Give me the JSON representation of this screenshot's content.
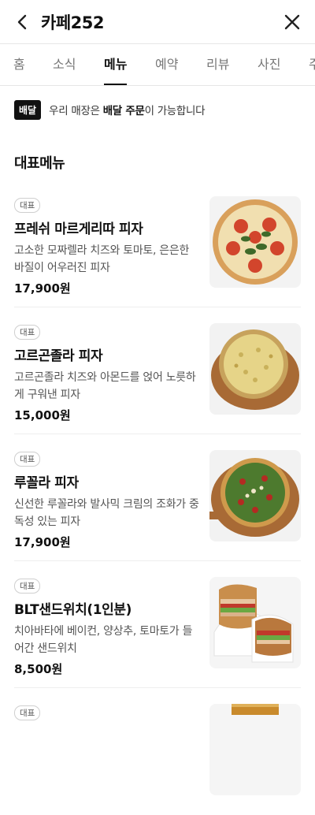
{
  "header": {
    "title": "카페252",
    "back_icon": "chevron-left-icon",
    "close_icon": "close-icon"
  },
  "tabs": [
    {
      "label": "홈",
      "active": false
    },
    {
      "label": "소식",
      "active": false
    },
    {
      "label": "메뉴",
      "active": true
    },
    {
      "label": "예약",
      "active": false
    },
    {
      "label": "리뷰",
      "active": false
    },
    {
      "label": "사진",
      "active": false
    },
    {
      "label": "주",
      "active": false
    }
  ],
  "notice": {
    "badge": "배달",
    "text_before": "우리 매장은 ",
    "text_bold": "배달 주문",
    "text_after": "이 가능합니다"
  },
  "section": {
    "title": "대표메뉴"
  },
  "menu": [
    {
      "tag": "대표",
      "name": "프레쉬 마르게리따 피자",
      "desc": "고소한 모짜렐라 치즈와 토마토, 은은한 바질이 어우러진 피자",
      "price": "17,900원",
      "image": "margherita-pizza-image"
    },
    {
      "tag": "대표",
      "name": "고르곤졸라 피자",
      "desc": "고르곤졸라 치즈와 아몬드를 얹어 노릇하게 구워낸 피자",
      "price": "15,000원",
      "image": "gorgonzola-pizza-image"
    },
    {
      "tag": "대표",
      "name": "루꼴라 피자",
      "desc": "신선한 루꼴라와 발사믹 크림의 조화가 중독성 있는 피자",
      "price": "17,900원",
      "image": "arugula-pizza-image"
    },
    {
      "tag": "대표",
      "name": "BLT샌드위치(1인분)",
      "desc": "치아바타에 베이컨, 양상추, 토마토가 들어간 샌드위치",
      "price": "8,500원",
      "image": "blt-sandwich-image"
    },
    {
      "tag": "대표",
      "name": "",
      "desc": "",
      "price": "",
      "image": "drink-image"
    }
  ]
}
